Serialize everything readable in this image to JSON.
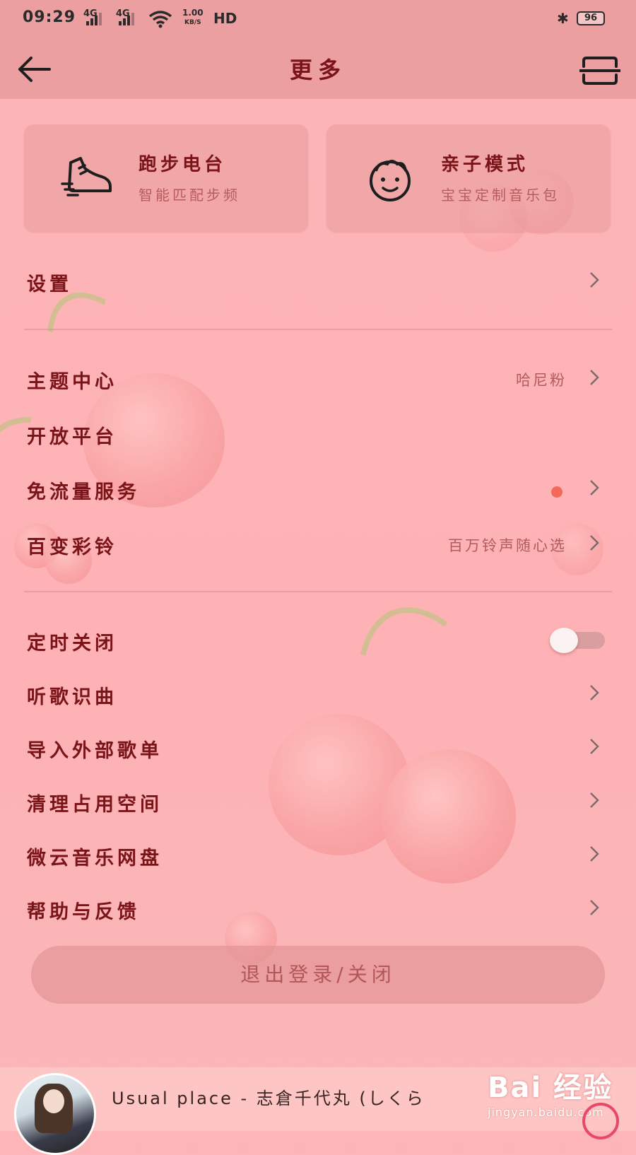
{
  "status_bar": {
    "time": "09:29",
    "net1": "4G",
    "net2": "4G",
    "speed_value": "1.00",
    "speed_unit": "KB/S",
    "hd": "HD",
    "battery": "96"
  },
  "header": {
    "title": "更多"
  },
  "cards": [
    {
      "title": "跑步电台",
      "subtitle": "智能匹配步频",
      "icon": "running-shoe-icon"
    },
    {
      "title": "亲子模式",
      "subtitle": "宝宝定制音乐包",
      "icon": "baby-face-icon"
    }
  ],
  "menu": {
    "settings": {
      "label": "设置"
    },
    "theme_center": {
      "label": "主题中心",
      "value": "哈尼粉"
    },
    "open_platform": {
      "label": "开放平台"
    },
    "free_data": {
      "label": "免流量服务"
    },
    "ringtone": {
      "label": "百变彩铃",
      "value": "百万铃声随心选"
    },
    "sleep_timer": {
      "label": "定时关闭",
      "enabled": false
    },
    "song_recognition": {
      "label": "听歌识曲"
    },
    "import_playlist": {
      "label": "导入外部歌单"
    },
    "clean_storage": {
      "label": "清理占用空间"
    },
    "weiyun": {
      "label": "微云音乐网盘"
    },
    "help": {
      "label": "帮助与反馈"
    }
  },
  "logout_label": "退出登录/关闭",
  "player": {
    "song_title": "Usual place - 志倉千代丸 (しくら"
  },
  "watermark": {
    "main": "Bai 经验",
    "sub": "jingyan.baidu.com"
  },
  "colors": {
    "background": "#feb2b5",
    "accent_text": "#7a1418",
    "badge_dot": "#f26a5c"
  }
}
